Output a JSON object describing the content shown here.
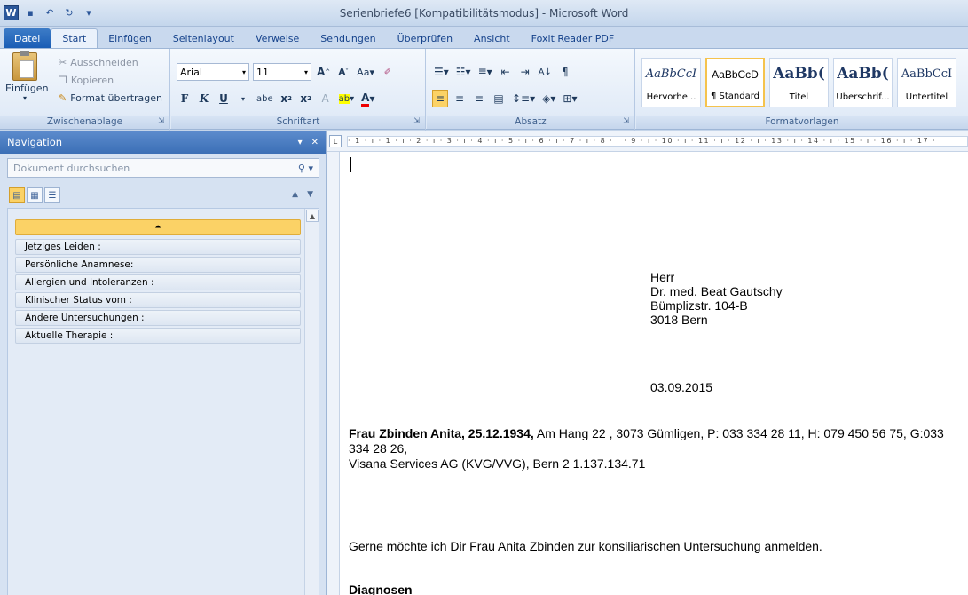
{
  "window": {
    "title": "Serienbriefe6 [Kompatibilitätsmodus] - Microsoft Word",
    "app_icon": "W"
  },
  "tabs": [
    "Datei",
    "Start",
    "Einfügen",
    "Seitenlayout",
    "Verweise",
    "Sendungen",
    "Überprüfen",
    "Ansicht",
    "Foxit Reader PDF"
  ],
  "active_tab": "Start",
  "ribbon": {
    "clipboard": {
      "paste": "Einfügen",
      "cut": "Ausschneiden",
      "copy": "Kopieren",
      "format_painter": "Format übertragen",
      "label": "Zwischenablage"
    },
    "font": {
      "family": "Arial",
      "size": "11",
      "label": "Schriftart"
    },
    "paragraph": {
      "label": "Absatz"
    },
    "styles": {
      "label": "Formatvorlagen",
      "tiles": [
        {
          "sample": "AaBbCcI",
          "name": "Hervorhe..."
        },
        {
          "sample": "AaBbCcD",
          "name": "¶ Standard"
        },
        {
          "sample": "AaBb(",
          "name": "Titel"
        },
        {
          "sample": "AaBb(",
          "name": "Überschrif..."
        },
        {
          "sample": "AaBbCcI",
          "name": "Untertitel"
        }
      ]
    }
  },
  "navigation": {
    "title": "Navigation",
    "search_placeholder": "Dokument durchsuchen",
    "headings": [
      "Jetziges Leiden :",
      "Persönliche Anamnese:",
      "Allergien und Intoleranzen :",
      "Klinischer Status vom :",
      "Andere Untersuchungen :",
      "Aktuelle Therapie :"
    ]
  },
  "ruler": {
    "ticks": "· 1 · ı · 1 · ı · 2 · ı · 3 · ı · 4 · ı · 5 · ı · 6 · ı · 7 · ı · 8 · ı · 9 · ı · 10 · ı · 11 · ı · 12 · ı · 13 · ı · 14 · ı · 15 · ı · 16 · ı · 17 ·"
  },
  "document": {
    "address": [
      "Herr",
      "Dr. med. Beat Gautschy",
      "Bümplizstr. 104-B",
      "3018 Bern"
    ],
    "date": "03.09.2015",
    "patient_bold": "Frau Zbinden Anita, 25.12.1934,",
    "patient_rest": " Am Hang 22 , 3073 Gümligen, P: 033 334 28 11, H: 079 450 56 75, G:033 334 28 26,",
    "insurance": "Visana Services AG (KVG/VVG), Bern 2 1.137.134.71",
    "intro": "Gerne möchte ich Dir Frau Anita Zbinden zur konsiliarischen Untersuchung anmelden.",
    "diagnoses_heading": "Diagnosen"
  }
}
